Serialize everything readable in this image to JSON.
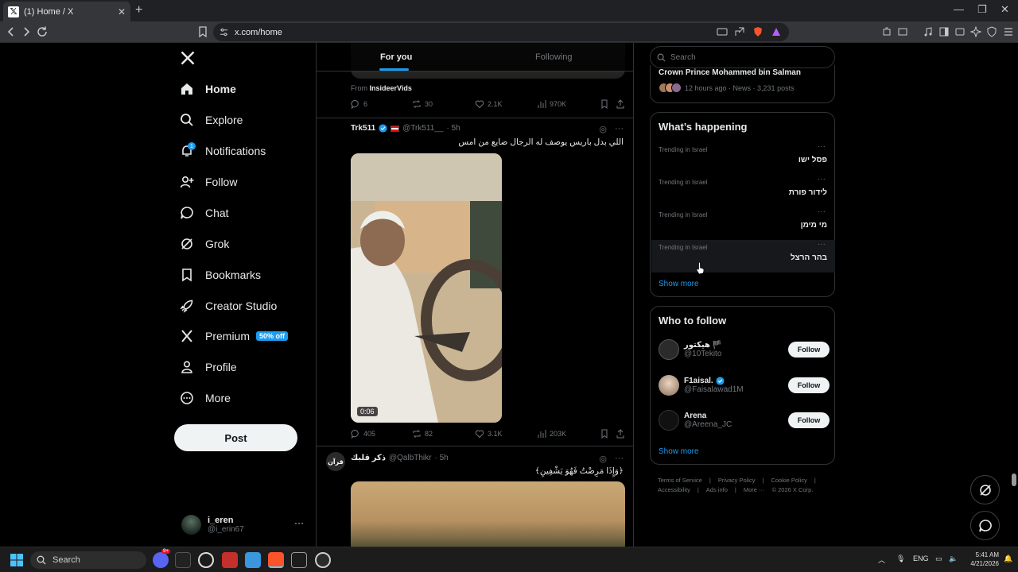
{
  "browser": {
    "tab_title": "(1) Home / X",
    "new_tab": "+",
    "url": "x.com/home"
  },
  "left_nav": {
    "items": [
      {
        "label": "Home",
        "icon": "home-icon"
      },
      {
        "label": "Explore",
        "icon": "search-icon"
      },
      {
        "label": "Notifications",
        "icon": "bell-icon",
        "badge": "1"
      },
      {
        "label": "Follow",
        "icon": "person-plus-icon"
      },
      {
        "label": "Chat",
        "icon": "chat-bubble-icon"
      },
      {
        "label": "Grok",
        "icon": "grok-icon"
      },
      {
        "label": "Bookmarks",
        "icon": "bookmark-icon"
      },
      {
        "label": "Creator Studio",
        "icon": "rocket-icon"
      },
      {
        "label": "Premium",
        "icon": "x-icon",
        "promo": "50% off"
      },
      {
        "label": "Profile",
        "icon": "person-icon"
      },
      {
        "label": "More",
        "icon": "more-circle-icon"
      }
    ],
    "post_label": "Post",
    "account": {
      "name": "i_eren",
      "handle": "@i_erin67",
      "menu": "···"
    }
  },
  "feed": {
    "tabs": [
      "For you",
      "Following"
    ],
    "prev_post": {
      "from_prefix": "From",
      "from_name": "InsideerVids",
      "replies": "6",
      "reposts": "30",
      "likes": "2.1K",
      "views": "970K"
    },
    "post1": {
      "name": "Trk511",
      "handle": "@Trk511__",
      "time": "· 5h",
      "text": "اللي بدل باريس يوصف له الرجال ضايع من امس",
      "duration": "0:06",
      "replies": "405",
      "reposts": "82",
      "likes": "3.1K",
      "views": "203K"
    },
    "post2": {
      "avatar_text": "قرآن",
      "name": "ذكر قلبك",
      "handle": "@QalbThikr",
      "time": "· 5h",
      "text": "﴿وَإِذَا مَرِضْتُ فَهُوَ يَشْفِينِ﴾"
    }
  },
  "sidebar": {
    "search_placeholder": "Search",
    "news": {
      "title": "Crown Prince Mohammed bin Salman",
      "meta": "12 hours ago · News · 3,231 posts"
    },
    "happening": {
      "title": "What’s happening",
      "trends": [
        {
          "context": "Trending in Israel",
          "name": "פסל ישו"
        },
        {
          "context": "Trending in Israel",
          "name": "לידור פורת"
        },
        {
          "context": "Trending in Israel",
          "name": "מי מימן"
        },
        {
          "context": "Trending in Israel",
          "name": "בהר הרצל"
        }
      ],
      "show_more": "Show more"
    },
    "who_to_follow": {
      "title": "Who to follow",
      "accounts": [
        {
          "name": "هيكتور 🏴",
          "handle": "@10Tekito",
          "button": "Follow"
        },
        {
          "name": "F1aisal.",
          "handle": "@Faisalawad1M",
          "button": "Follow"
        },
        {
          "name": "Arena",
          "handle": "@Areena_JC",
          "button": "Follow"
        }
      ],
      "show_more": "Show more"
    },
    "footer": [
      "Terms of Service",
      "|",
      "Privacy Policy",
      "|",
      "Cookie Policy",
      "|",
      "Accessibility",
      "|",
      "Ads info",
      "|",
      "More ···",
      "© 2026 X Corp."
    ]
  },
  "taskbar": {
    "search_placeholder": "Search",
    "lang": "ENG",
    "time": "5:41 AM",
    "date": "4/21/2026",
    "discord_badge": "9+"
  },
  "colors": {
    "accent": "#1d9bf0",
    "background": "#000000",
    "border": "#2f3336",
    "muted": "#71767b"
  }
}
